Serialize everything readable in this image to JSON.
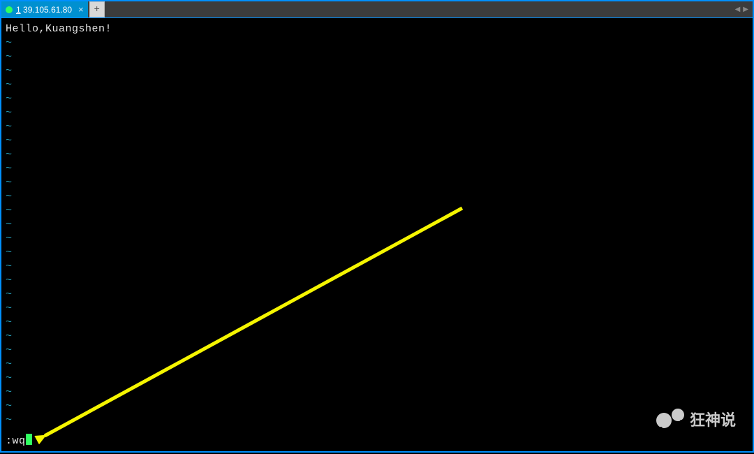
{
  "tabs": {
    "active": {
      "index_prefix": "1",
      "label": "39.105.61.80"
    },
    "new_tab_symbol": "+"
  },
  "nav": {
    "prev": "◀",
    "next": "▶"
  },
  "terminal": {
    "content_line": "Hello,Kuangshen!",
    "tilde": "~",
    "tilde_rows": 28,
    "command": ":wq"
  },
  "watermark": {
    "text": "狂神说"
  },
  "colors": {
    "tab_bg": "#0090d0",
    "accent_border": "#0090ff",
    "tilde": "#26a2bf",
    "cursor": "#30ff60",
    "arrow": "#f5f500"
  }
}
